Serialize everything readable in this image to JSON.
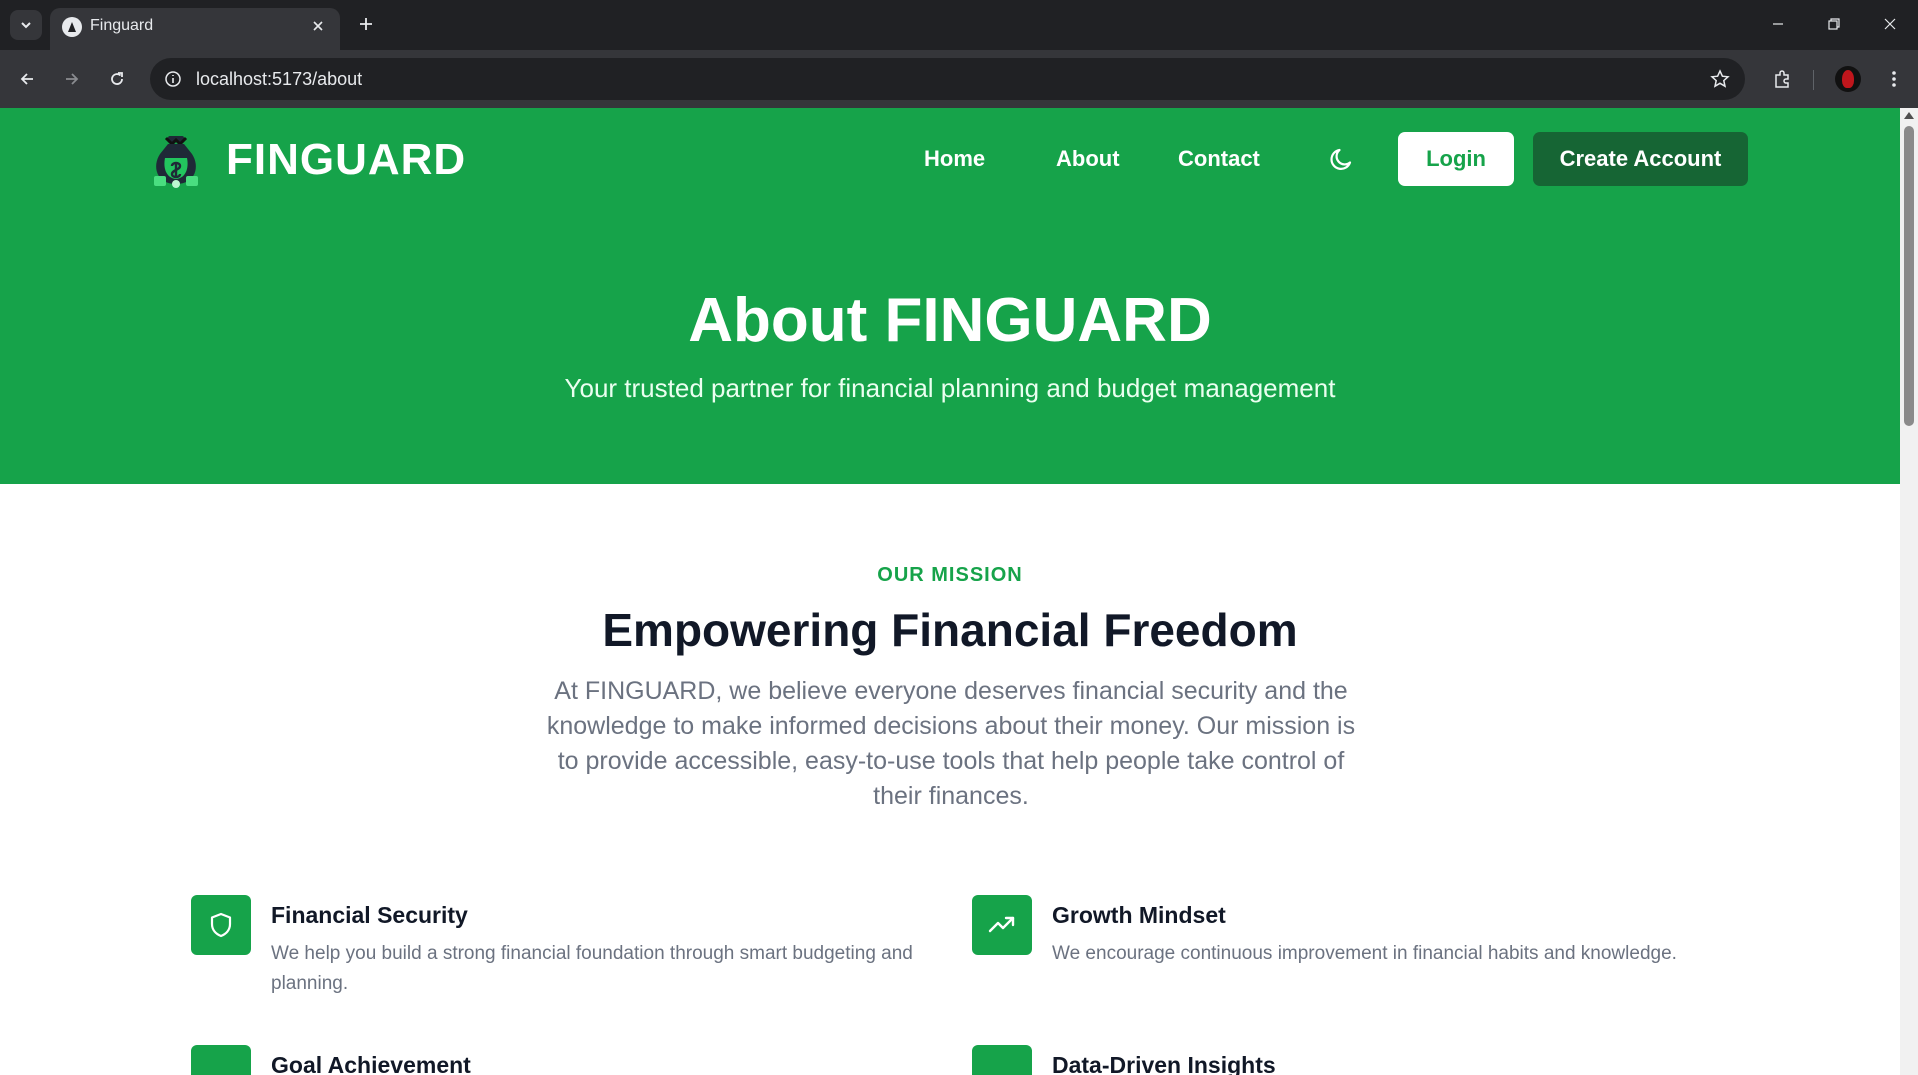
{
  "browser": {
    "tab_title": "Finguard",
    "url": "localhost:5173/about"
  },
  "nav": {
    "brand": "FINGUARD",
    "links": [
      "Home",
      "About",
      "Contact"
    ],
    "login": "Login",
    "create_account": "Create Account"
  },
  "hero": {
    "title": "About FINGUARD",
    "subtitle": "Your trusted partner for financial planning and budget management"
  },
  "mission": {
    "eyebrow": "OUR MISSION",
    "title": "Empowering Financial Freedom",
    "text": "At FINGUARD, we believe everyone deserves financial security and the knowledge to make informed decisions about their money. Our mission is to provide accessible, easy-to-use tools that help people take control of their finances."
  },
  "features": [
    {
      "icon": "shield-icon",
      "title": "Financial Security",
      "desc": "We help you build a strong financial foundation through smart budgeting and planning."
    },
    {
      "icon": "trending-up-icon",
      "title": "Growth Mindset",
      "desc": "We encourage continuous improvement in financial habits and knowledge."
    },
    {
      "icon": "target-icon",
      "title": "Goal Achievement",
      "desc": ""
    },
    {
      "icon": "pie-chart-icon",
      "title": "Data-Driven Insights",
      "desc": ""
    }
  ],
  "colors": {
    "primary": "#16a34a",
    "primary_dark": "#166534",
    "heading": "#111827",
    "muted": "#6b7280"
  }
}
